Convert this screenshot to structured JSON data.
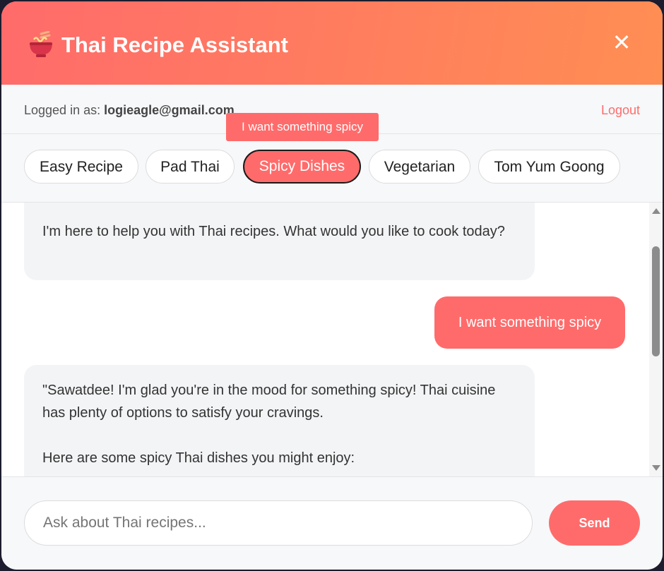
{
  "header": {
    "title": "Thai Recipe Assistant",
    "icon": "noodle-bowl-icon",
    "close_label": "✕"
  },
  "user": {
    "logged_in_prefix": "Logged in as:",
    "email": "logieagle@gmail.com",
    "logout_label": "Logout"
  },
  "quick_replies": [
    {
      "label": "Easy Recipe",
      "active": false
    },
    {
      "label": "Pad Thai",
      "active": false
    },
    {
      "label": "Spicy Dishes",
      "active": true
    },
    {
      "label": "Vegetarian",
      "active": false
    },
    {
      "label": "Tom Yum Goong",
      "active": false
    }
  ],
  "tooltip": {
    "text": "I want something spicy"
  },
  "messages": {
    "bot_1": "I'm here to help you with Thai recipes. What would you like to cook today?",
    "user_1": "I want something spicy",
    "bot_2_p1": "\"Sawatdee! I'm glad you're in the mood for something spicy! Thai cuisine has plenty of options to satisfy your cravings.",
    "bot_2_p2": "Here are some spicy Thai dishes you might enjoy:"
  },
  "composer": {
    "placeholder": "Ask about Thai recipes...",
    "value": "",
    "send_label": "Send"
  },
  "colors": {
    "accent": "#ff6b6b",
    "header_gradient_end": "#ff8e53",
    "bot_bubble": "#f3f4f6",
    "panel_bg": "#f7f8fa"
  }
}
